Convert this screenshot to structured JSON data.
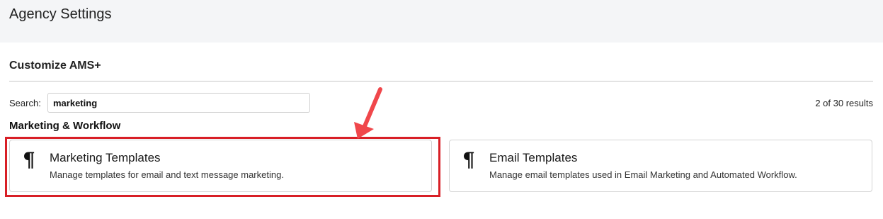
{
  "header": {
    "title": "Agency Settings"
  },
  "section": {
    "title": "Customize AMS+"
  },
  "search": {
    "label": "Search:",
    "value": "marketing",
    "results": "2 of 30 results"
  },
  "category": {
    "title": "Marketing & Workflow"
  },
  "cards": [
    {
      "icon": "pilcrow-icon",
      "glyph": "¶",
      "title": "Marketing Templates",
      "description": "Manage templates for email and text message marketing."
    },
    {
      "icon": "pilcrow-icon",
      "glyph": "¶",
      "title": "Email Templates",
      "description": "Manage email templates used in Email Marketing and Automated Workflow."
    }
  ],
  "annotation": {
    "highlight_color": "#d81f26",
    "arrow_color": "#f0474b"
  }
}
